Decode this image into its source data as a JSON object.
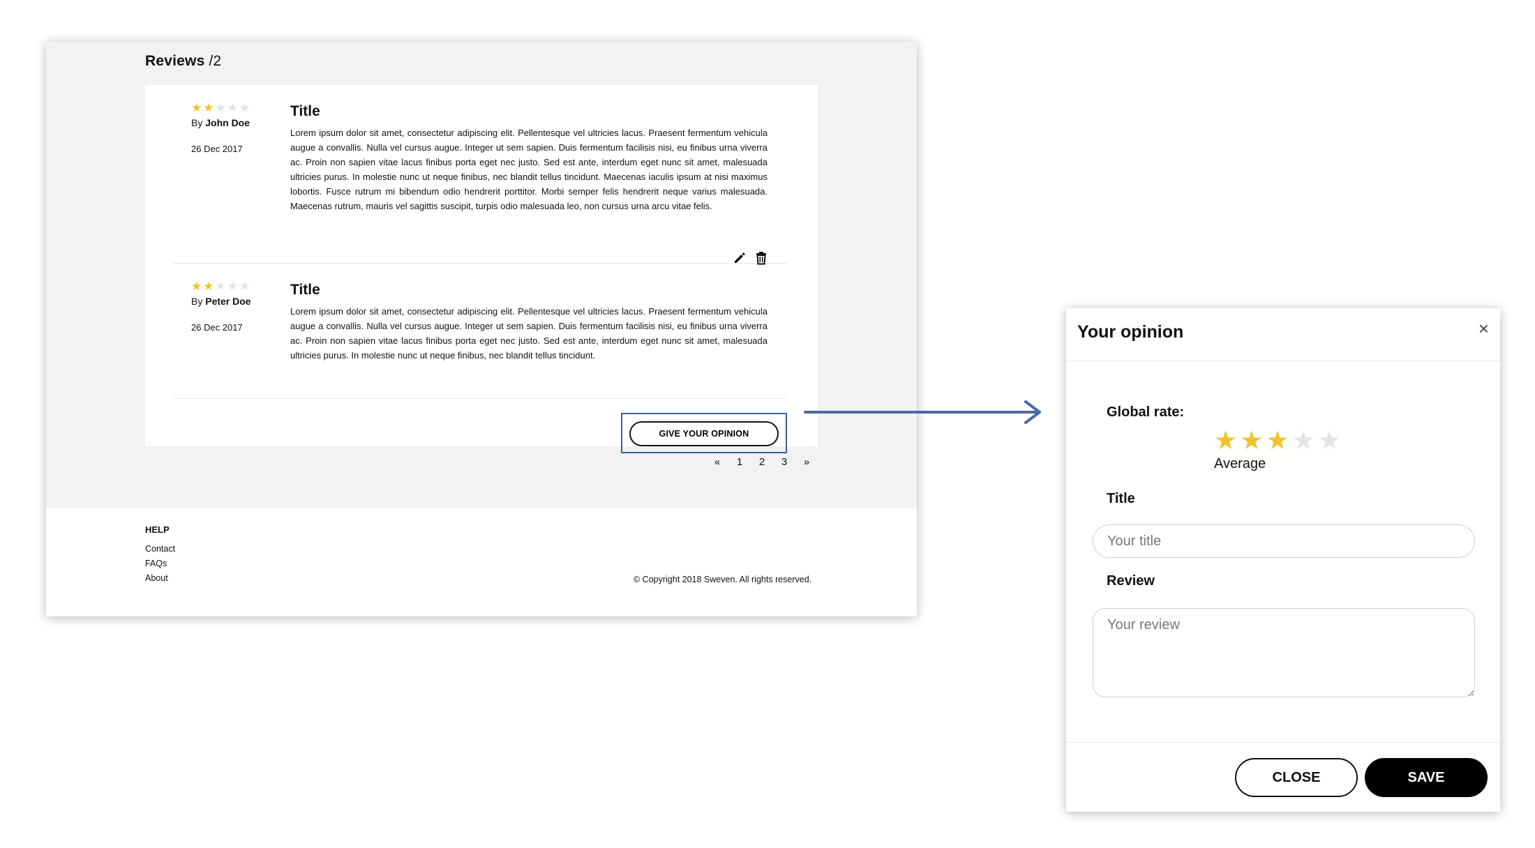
{
  "page": {
    "reviews_title": "Reviews",
    "reviews_count": "/2",
    "reviews": [
      {
        "rating": 2,
        "max_rating": 5,
        "by_label": "By ",
        "author": "John Doe",
        "date": "26 Dec 2017",
        "title": "Title",
        "text": "Lorem ipsum dolor sit amet, consectetur adipiscing elit. Pellentesque vel ultricies lacus. Praesent fermentum vehicula augue a convallis. Nulla vel cursus augue. Integer ut sem sapien. Duis fermentum facilisis nisi, eu finibus urna viverra ac. Proin non sapien vitae lacus finibus porta eget nec justo. Sed est ante, interdum eget nunc sit amet, malesuada ultricies purus. In molestie nunc ut neque finibus, nec blandit tellus tincidunt. Maecenas iaculis ipsum at nisi maximus lobortis. Fusce rutrum mi bibendum odio hendrerit porttitor. Morbi semper felis hendrerit neque varius malesuada. Maecenas rutrum, mauris vel sagittis suscipit, turpis odio malesuada leo, non cursus urna arcu vitae felis.",
        "actions": [
          "pencil-icon",
          "trash-icon"
        ]
      },
      {
        "rating": 2,
        "max_rating": 5,
        "by_label": "By ",
        "author": "Peter Doe",
        "date": "26 Dec 2017",
        "title": "Title",
        "text": "Lorem ipsum dolor sit amet, consectetur adipiscing elit. Pellentesque vel ultricies lacus. Praesent fermentum vehicula augue a convallis. Nulla vel cursus augue. Integer ut sem sapien. Duis fermentum facilisis nisi, eu finibus urna viverra ac. Proin non sapien vitae lacus finibus porta eget nec justo. Sed est ante, interdum eget nunc sit amet, malesuada ultricies purus. In molestie nunc ut neque finibus, nec blandit tellus tincidunt."
      }
    ],
    "give_opinion_label": "GIVE YOUR OPINION",
    "pagination": [
      "«",
      "1",
      "2",
      "3",
      "»"
    ],
    "footer": {
      "heading": "HELP",
      "links": [
        "Contact",
        "FAQs",
        "About"
      ],
      "copyright": "© Copyright 2018 Sweven. All rights reserved."
    }
  },
  "modal": {
    "title": "Your opinion",
    "close_icon": "×",
    "global_rate_label": "Global rate:",
    "rating": 3,
    "max_rating": 5,
    "rating_text": "Average",
    "title_label": "Title",
    "title_placeholder": "Your title",
    "review_label": "Review",
    "review_placeholder": "Your review",
    "close_label": "CLOSE",
    "save_label": "SAVE"
  },
  "colors": {
    "star_on": "#f2c12e",
    "star_off": "#e3e3e3",
    "highlight": "#3c5fa4",
    "arrow": "#4a68a8",
    "page_bg": "#f2f2f2"
  }
}
